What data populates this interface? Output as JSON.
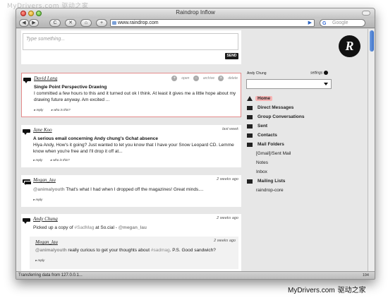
{
  "watermark_top": "MyDrivers.com 驱动之家",
  "watermark_bottom": {
    "site": "MyDrivers.com",
    "name": "驱动之家"
  },
  "window": {
    "title": "Raindrop Inflow"
  },
  "toolbar": {
    "back": "◀",
    "forward": "▶",
    "reload": "C",
    "stop": "✕",
    "home": "⌂",
    "add_bookmark": "+",
    "url": "www.raindrop.com",
    "search_placeholder": "Google"
  },
  "composer": {
    "placeholder": "Type something...",
    "send_label": "SEND"
  },
  "posts": [
    {
      "author": "David Lang",
      "subject": "Single Point Perspective Drawing",
      "body": "I committed a few hours to this and it turned out ok I think. At least it gives me a little hope about my drawing future anyway. Am excited ...",
      "actions": {
        "open": "open",
        "archive": "archive",
        "delete": "delete"
      },
      "reply": "reply",
      "who": "who is this?"
    },
    {
      "author": "Jane Koo",
      "time": "last week",
      "subject": "A serious email concerning Andy chung's Gchat absence",
      "body": "Hiya Andy, How's it going? Just wanted to let you know that I have your Snow Leopard CD. Lemme know when you're free and I'll drop it off at...",
      "reply": "reply",
      "who": "who is this?"
    },
    {
      "author": "Megan_lau",
      "time": "2 weeks ago",
      "mention": "@animalyouth",
      "body": " That's what I had when I dropped off the magazines! Great minds....",
      "reply": "reply"
    },
    {
      "author": "Andy Chung",
      "time": "2 weeks ago",
      "body_pre": "Picked up a copy of ",
      "tag": "#SadMag",
      "body_mid": " at So.cial - ",
      "mention": "@megan_lau",
      "reply": {
        "author": "Megan_lau",
        "time": "2 weeks ago",
        "mention": "@animalyouth",
        "body_pre": " really curious to get your thoughts about ",
        "tag": "#sadmag",
        "body_post": ". P.S. Good sandwich?",
        "reply": "reply"
      }
    }
  ],
  "sidebar": {
    "logo": "R",
    "user": "Andy Chung",
    "settings": "settings",
    "nav": {
      "home": "Home",
      "direct": "Direct Messages",
      "group": "Group Conversations",
      "sent": "Sent",
      "contacts": "Contacts",
      "folders": "Mail Folders",
      "folder_items": [
        "[Gmail]/Sent Mail",
        "Notes",
        "Inbox"
      ],
      "lists": "Mailing Lists",
      "list_items": [
        "raindrop-core"
      ]
    }
  },
  "status": {
    "text": "Transferring data from 127.0.0.1...",
    "count": "194"
  }
}
